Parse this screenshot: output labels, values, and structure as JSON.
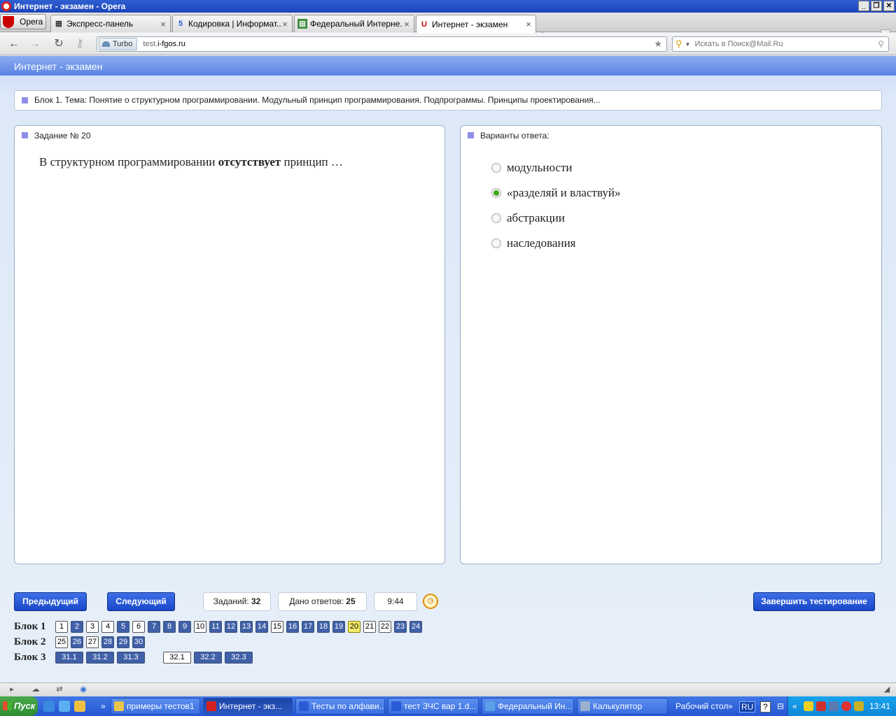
{
  "window": {
    "title": "Интернет - экзамен - Opera",
    "controls": [
      "_",
      "❐",
      "✕"
    ]
  },
  "browser": {
    "menu_label": "Opera",
    "tabs": [
      {
        "label": "Экспресс-панель",
        "icon": "speed-dial-icon"
      },
      {
        "label": "Кодировка | Информат...",
        "icon": "site-favicon"
      },
      {
        "label": "Федеральный Интерне...",
        "icon": "site-favicon"
      },
      {
        "label": "Интернет - экзамен",
        "icon": "site-favicon",
        "active": true
      }
    ],
    "turbo_label": "Turbo",
    "url_dim": "test.",
    "url_main": "i-fgos.ru",
    "search_placeholder": "Искать в Поиск@Mail.Ru"
  },
  "page": {
    "header_title": "Интернет - экзамен",
    "block_title": "Блок 1. Тема: Понятие о структурном программировании. Модульный принцип программирования. Подпрограммы. Принципы проектирования...",
    "question_panel_title": "Задание № 20",
    "question_pre": "В структурном программировании ",
    "question_bold": "отсутствует",
    "question_post": " принцип …",
    "answer_panel_title": "Варианты ответа:",
    "options": [
      {
        "label": "модульности",
        "selected": false
      },
      {
        "label": "«разделяй и властвуй»",
        "selected": true
      },
      {
        "label": "абстракции",
        "selected": false
      },
      {
        "label": "наследования",
        "selected": false
      }
    ],
    "prev_button": "Предыдущий",
    "next_button": "Следующий",
    "tasks_label": "Заданий:",
    "tasks_count": "32",
    "answered_label": "Дано ответов:",
    "answered_count": "25",
    "timer": "9:44",
    "finish_button": "Завершить тестирование",
    "blocks": [
      {
        "label": "Блок 1",
        "items": [
          {
            "n": "1",
            "s": "w"
          },
          {
            "n": "2",
            "s": "b"
          },
          {
            "n": "3",
            "s": "w"
          },
          {
            "n": "4",
            "s": "w"
          },
          {
            "n": "5",
            "s": "b"
          },
          {
            "n": "6",
            "s": "w"
          },
          {
            "n": "7",
            "s": "b"
          },
          {
            "n": "8",
            "s": "b"
          },
          {
            "n": "9",
            "s": "b"
          },
          {
            "n": "10",
            "s": "w"
          },
          {
            "n": "11",
            "s": "b"
          },
          {
            "n": "12",
            "s": "b"
          },
          {
            "n": "13",
            "s": "b"
          },
          {
            "n": "14",
            "s": "b"
          },
          {
            "n": "15",
            "s": "w"
          },
          {
            "n": "16",
            "s": "b"
          },
          {
            "n": "17",
            "s": "b"
          },
          {
            "n": "18",
            "s": "b"
          },
          {
            "n": "19",
            "s": "b"
          },
          {
            "n": "20",
            "s": "y"
          },
          {
            "n": "21",
            "s": "w"
          },
          {
            "n": "22",
            "s": "w"
          },
          {
            "n": "23",
            "s": "b"
          },
          {
            "n": "24",
            "s": "b"
          }
        ]
      },
      {
        "label": "Блок 2",
        "items": [
          {
            "n": "25",
            "s": "w"
          },
          {
            "n": "26",
            "s": "b"
          },
          {
            "n": "27",
            "s": "w"
          },
          {
            "n": "28",
            "s": "b"
          },
          {
            "n": "29",
            "s": "b"
          },
          {
            "n": "30",
            "s": "b"
          }
        ]
      },
      {
        "label": "Блок 3",
        "items": [
          {
            "n": "31.1",
            "s": "b"
          },
          {
            "n": "31.2",
            "s": "b"
          },
          {
            "n": "31.3",
            "s": "b"
          },
          {
            "n": "32.1",
            "s": "w",
            "gap_before": true
          },
          {
            "n": "32.2",
            "s": "b"
          },
          {
            "n": "32.3",
            "s": "b"
          }
        ]
      }
    ]
  },
  "taskbar": {
    "start_label": "Пуск",
    "tasks": [
      {
        "label": "примеры тестов1",
        "active": false,
        "color": "#e8c64a"
      },
      {
        "label": "Интернет - экз...",
        "active": true,
        "color": "#d42020"
      },
      {
        "label": "Тесты по алфави...",
        "active": false,
        "color": "#2a5bd7"
      },
      {
        "label": "тест ЗЧС вар 1.d...",
        "active": false,
        "color": "#2a5bd7"
      },
      {
        "label": "Федеральный Ин...",
        "active": false,
        "color": "#5aa0e8"
      },
      {
        "label": "Калькулятор",
        "active": false,
        "color": "#9ab0d0"
      }
    ],
    "desktop_label": "Рабочий стол",
    "lang": "RU",
    "time": "13:41"
  },
  "colors": {
    "header_blue": "#5a83e3",
    "button_blue": "#1848c8",
    "selected_radio": "#3caa1a",
    "current_task": "#f4ec6a",
    "answered_task": "#4060a8"
  }
}
